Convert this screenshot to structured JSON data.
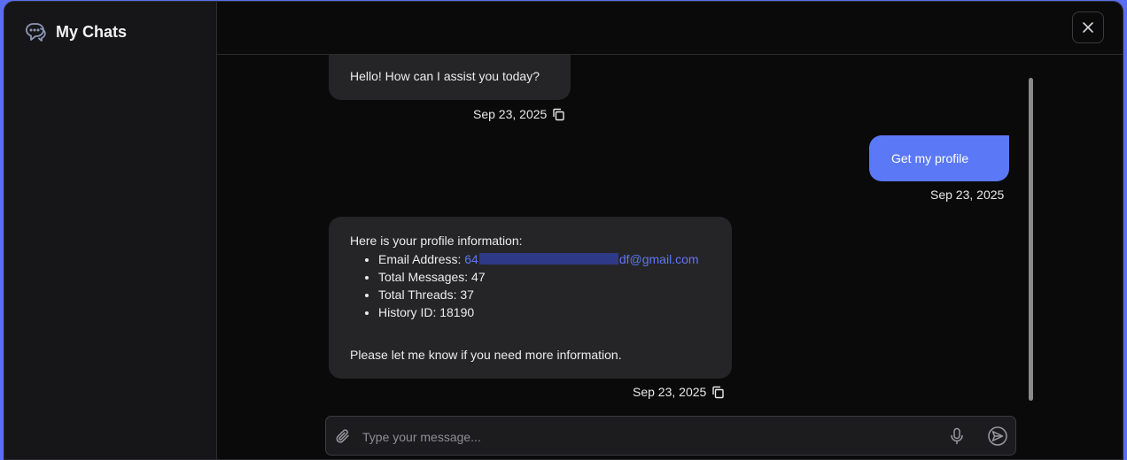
{
  "sidebar": {
    "title": "My Chats"
  },
  "messages": [
    {
      "role": "assistant",
      "text": "Hello! How can I assist you today?",
      "date": "Sep 23, 2025"
    },
    {
      "role": "user",
      "text": "Get my profile",
      "date": "Sep 23, 2025"
    },
    {
      "role": "assistant",
      "intro": "Here is your profile information:",
      "items": {
        "email_label": "Email Address: ",
        "email_prefix": "64",
        "email_suffix": "df@gmail.com",
        "total_messages": "Total Messages: 47",
        "total_threads": "Total Threads: 37",
        "history_id": "History ID: 18190"
      },
      "outro": "Please let me know if you need more information.",
      "date": "Sep 23, 2025"
    }
  ],
  "composer": {
    "placeholder": "Type your message..."
  },
  "colors": {
    "accent": "#5b78f6",
    "bubble": "#252527",
    "background": "#0a0a0a",
    "sidebar": "#161618"
  },
  "icons": [
    "chat-bubbles-icon",
    "close-icon",
    "copy-icon",
    "paperclip-icon",
    "microphone-icon",
    "send-icon"
  ]
}
